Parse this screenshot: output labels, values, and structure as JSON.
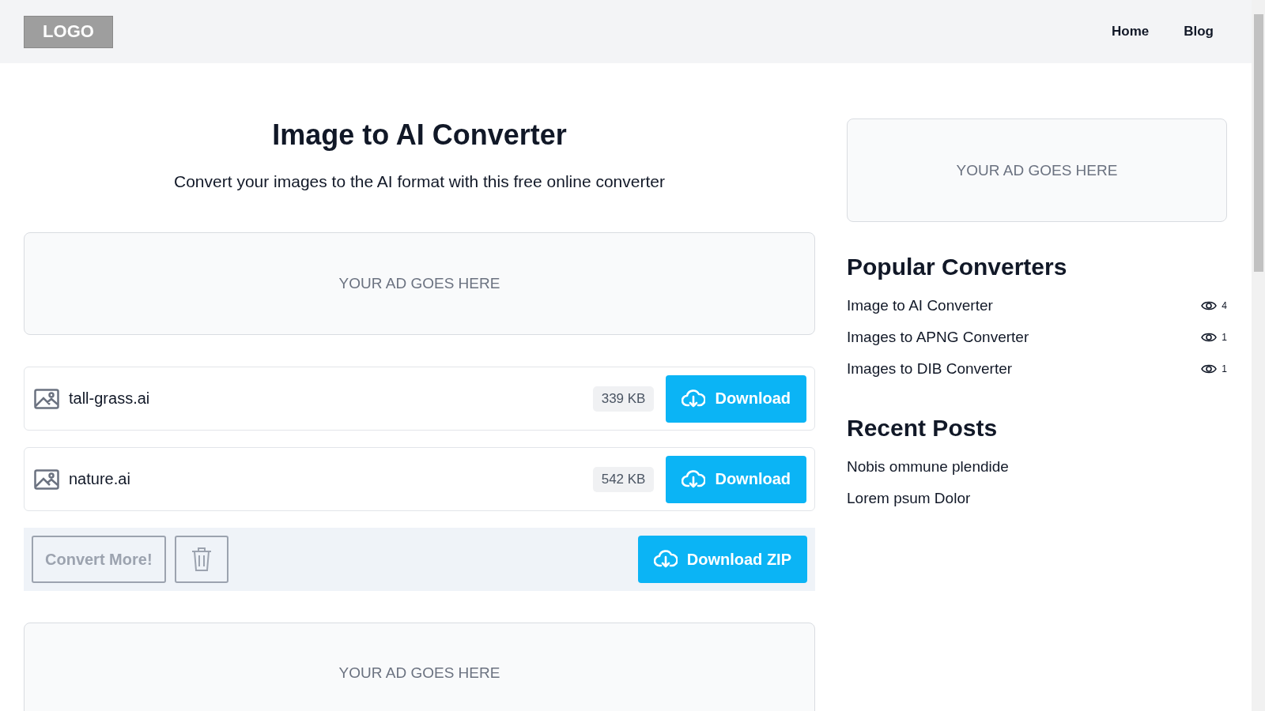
{
  "header": {
    "logo": "LOGO",
    "nav": [
      "Home",
      "Blog"
    ]
  },
  "main": {
    "title": "Image to AI Converter",
    "subtitle": "Convert your images to the AI format with this free online converter",
    "ad_top": "YOUR AD GOES HERE",
    "files": [
      {
        "name": "tall-grass.ai",
        "size": "339 KB",
        "button": "Download"
      },
      {
        "name": "nature.ai",
        "size": "542 KB",
        "button": "Download"
      }
    ],
    "actions": {
      "convert_more": {
        "label": "Convert More!",
        "disabled": true
      },
      "download_zip": "Download ZIP"
    },
    "ad_bottom": "YOUR AD GOES HERE"
  },
  "sidebar": {
    "ad": "YOUR AD GOES HERE",
    "popular_title": "Popular Converters",
    "popular": [
      {
        "label": "Image to AI Converter",
        "views": "4"
      },
      {
        "label": "Images to APNG Converter",
        "views": "1"
      },
      {
        "label": "Images to DIB Converter",
        "views": "1"
      }
    ],
    "recent_title": "Recent Posts",
    "recent": [
      "Nobis ommune plendide",
      "Lorem psum Dolor"
    ]
  }
}
